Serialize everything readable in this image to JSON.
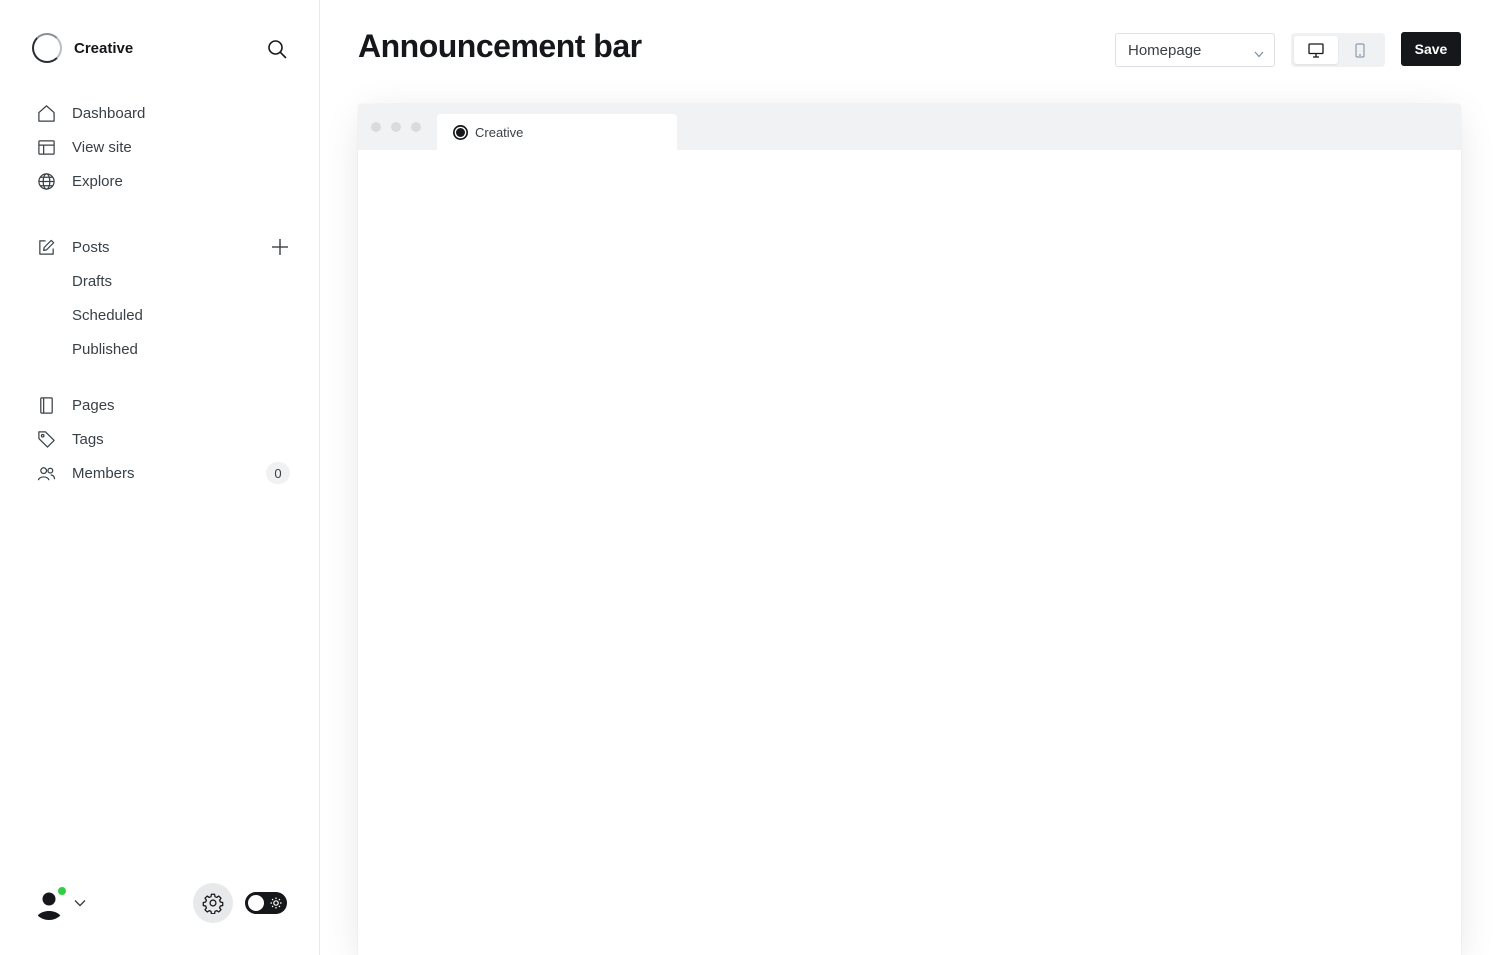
{
  "sidebar": {
    "brand_name": "Creative",
    "nav_primary": [
      {
        "label": "Dashboard",
        "icon": "home-icon"
      },
      {
        "label": "View site",
        "icon": "layout-icon"
      },
      {
        "label": "Explore",
        "icon": "globe-icon"
      }
    ],
    "posts": {
      "label": "Posts",
      "icon": "pencil-square-icon",
      "sub_items": [
        {
          "label": "Drafts"
        },
        {
          "label": "Scheduled"
        },
        {
          "label": "Published"
        }
      ]
    },
    "nav_secondary": [
      {
        "label": "Pages",
        "icon": "page-icon"
      },
      {
        "label": "Tags",
        "icon": "tag-icon"
      },
      {
        "label": "Members",
        "icon": "members-icon",
        "count": "0"
      }
    ],
    "online_status_color": "#30cf43"
  },
  "main": {
    "title": "Announcement bar",
    "page_select": {
      "selected": "Homepage"
    },
    "save_label": "Save",
    "accent_color": "#15171a"
  },
  "preview": {
    "tab_title": "Creative"
  }
}
